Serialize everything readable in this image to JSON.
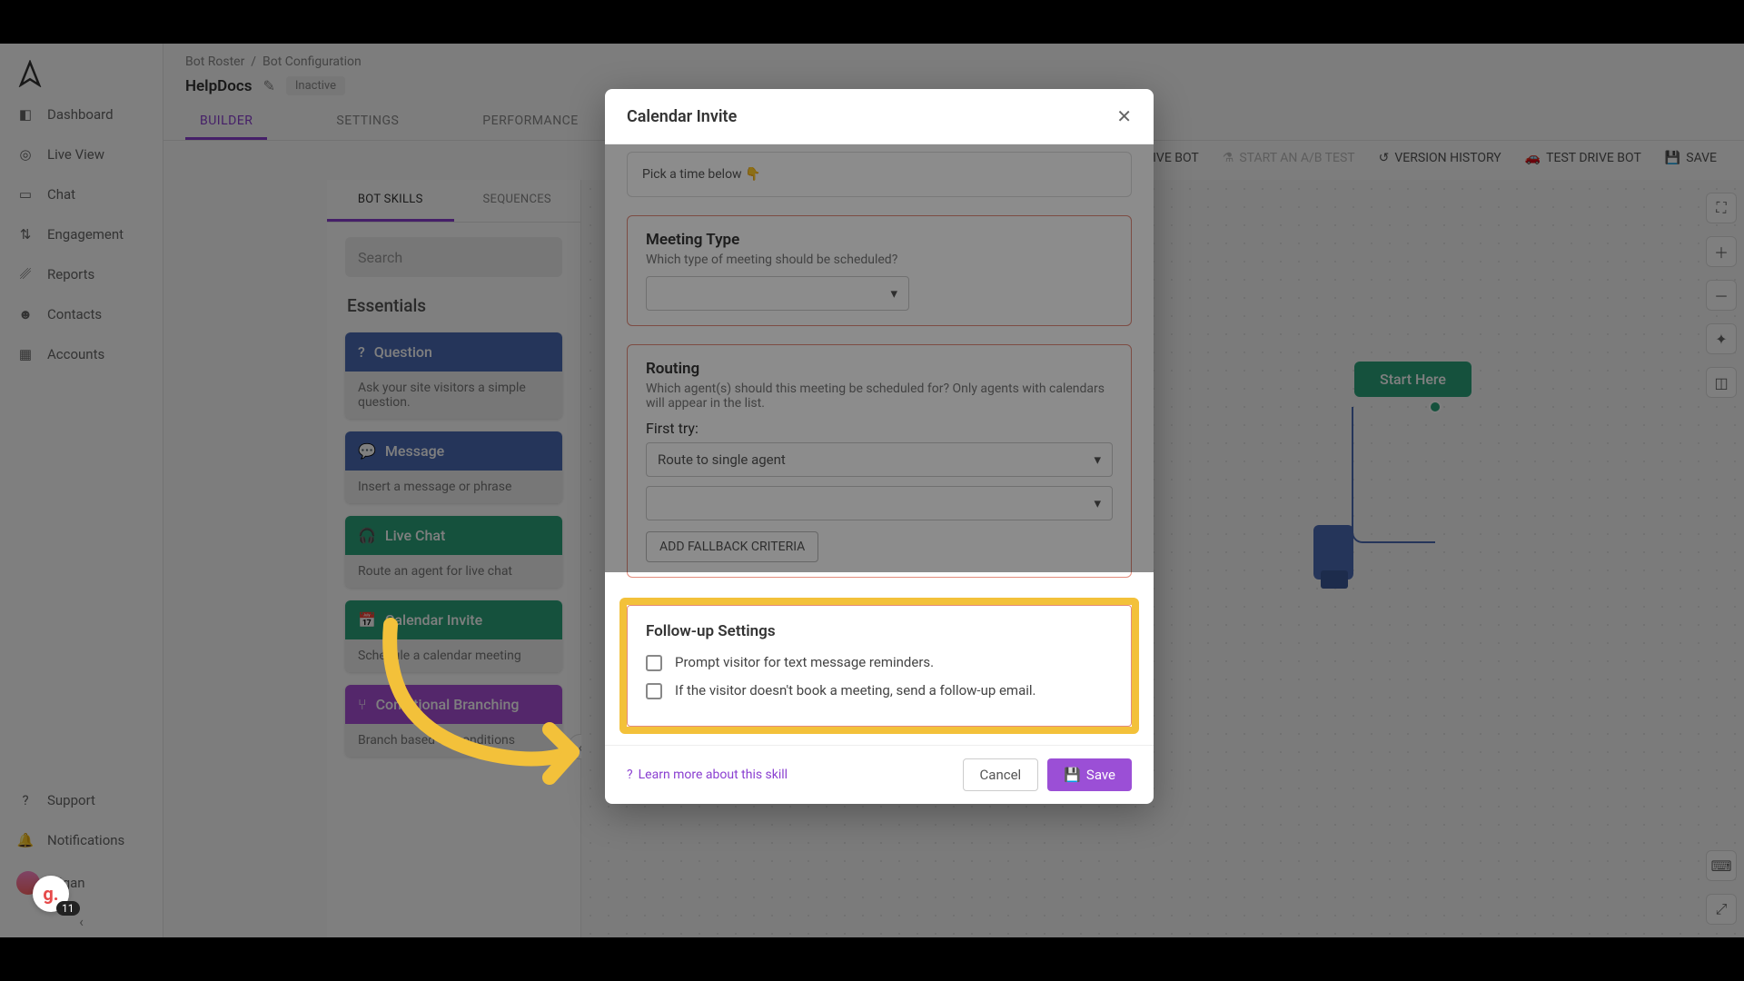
{
  "sidebar": {
    "items": [
      {
        "label": "Dashboard"
      },
      {
        "label": "Live View"
      },
      {
        "label": "Chat"
      },
      {
        "label": "Engagement"
      },
      {
        "label": "Reports"
      },
      {
        "label": "Contacts"
      },
      {
        "label": "Accounts"
      }
    ],
    "bottom": [
      {
        "label": "Support"
      },
      {
        "label": "Notifications"
      },
      {
        "label": "Ngan"
      }
    ],
    "badge_count": "11",
    "g_badge": "g."
  },
  "breadcrumb": {
    "root": "Bot Roster",
    "current": "Bot Configuration"
  },
  "page": {
    "title": "HelpDocs",
    "status": "Inactive"
  },
  "tabs": {
    "builder": "BUILDER",
    "settings": "SETTINGS",
    "performance": "PERFORMANCE"
  },
  "actions": {
    "archive": "ARCHIVE BOT",
    "abtest": "START AN A/B TEST",
    "version": "VERSION HISTORY",
    "testdrive": "TEST DRIVE BOT",
    "save": "SAVE"
  },
  "rail": {
    "tabs": {
      "skills": "BOT SKILLS",
      "sequences": "SEQUENCES"
    },
    "search_placeholder": "Search",
    "section": "Essentials",
    "skills": [
      {
        "title": "Question",
        "desc": "Ask your site visitors a simple question.",
        "cls": "sk-blue"
      },
      {
        "title": "Message",
        "desc": "Insert a message or phrase",
        "cls": "sk-blue"
      },
      {
        "title": "Live Chat",
        "desc": "Route an agent for live chat",
        "cls": "sk-green"
      },
      {
        "title": "Calendar Invite",
        "desc": "Schedule a calendar meeting",
        "cls": "sk-green"
      },
      {
        "title": "Conditional Branching",
        "desc": "Branch based on conditions",
        "cls": "sk-purple"
      }
    ]
  },
  "canvas": {
    "start": "Start Here"
  },
  "modal": {
    "title": "Calendar Invite",
    "pick_time": "Pick a time below 👇",
    "meeting_type": {
      "title": "Meeting Type",
      "sub": "Which type of meeting should be scheduled?"
    },
    "routing": {
      "title": "Routing",
      "sub": "Which agent(s) should this meeting be scheduled for? Only agents with calendars will appear in the list.",
      "first_try": "First try:",
      "route_option": "Route to single agent",
      "add_fallback": "ADD FALLBACK CRITERIA"
    },
    "followup": {
      "title": "Follow-up Settings",
      "opt1": "Prompt visitor for text message reminders.",
      "opt2": "If the visitor doesn't book a meeting, send a follow-up email."
    },
    "learn": "Learn more about this skill",
    "cancel": "Cancel",
    "save": "Save"
  }
}
